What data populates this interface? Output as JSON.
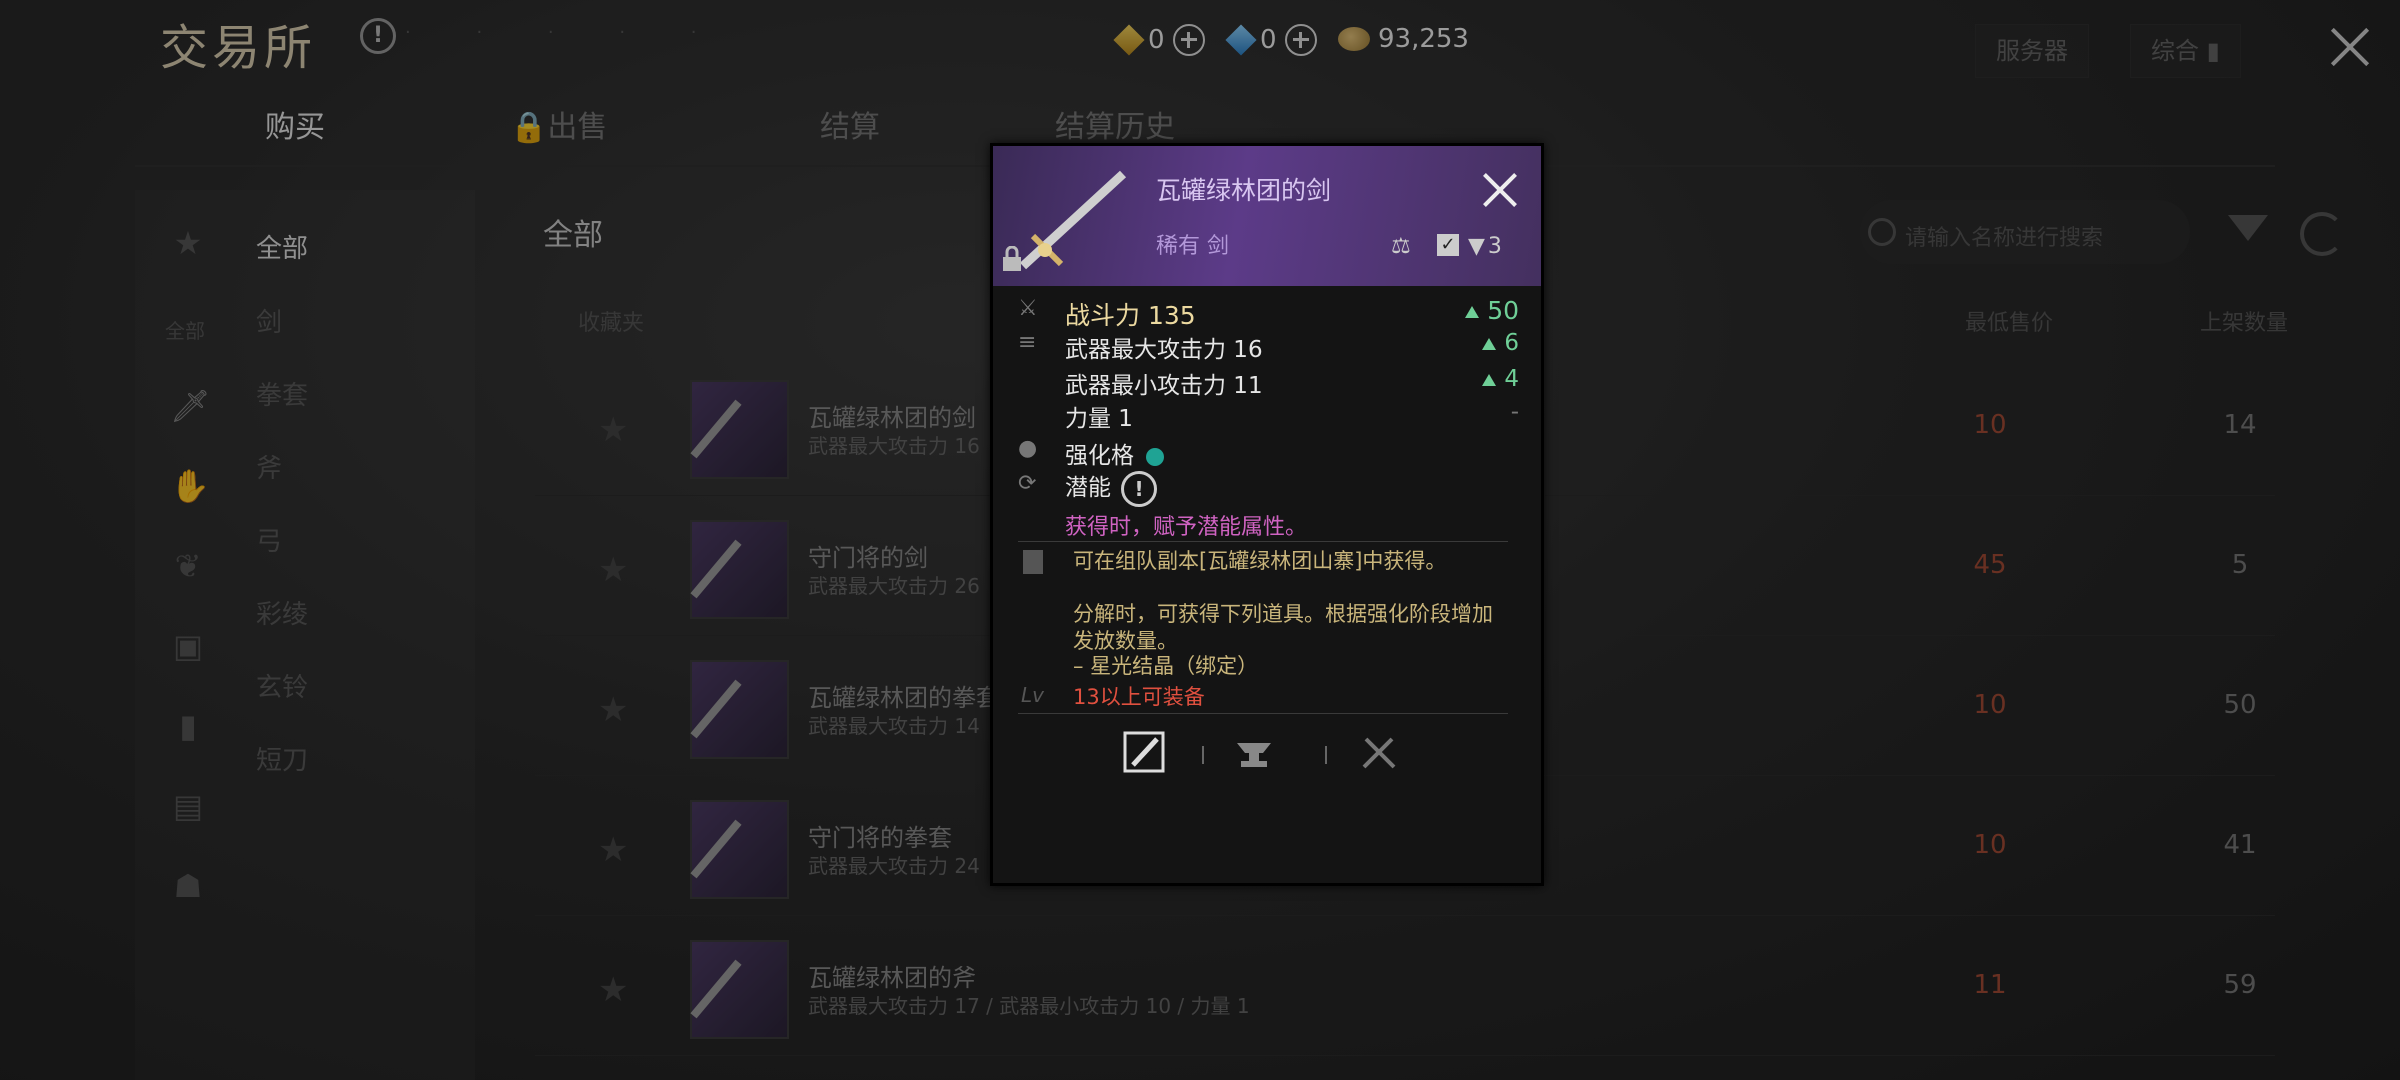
{
  "header": {
    "title": "交易所",
    "currencies": [
      {
        "icon": "gold-gem-icon",
        "value": "0"
      },
      {
        "icon": "blue-gem-icon",
        "value": "0"
      },
      {
        "icon": "coin-icon",
        "value": "93,253"
      }
    ],
    "server_label": "服务器",
    "general_label": "综合"
  },
  "tabs": [
    {
      "label": "购买",
      "active": true
    },
    {
      "label": "出售",
      "locked": true
    },
    {
      "label": "结算"
    },
    {
      "label": "结算历史"
    }
  ],
  "sidebar": {
    "icons": [
      "star-icon",
      "all-label",
      "sword-icon",
      "gauntlet-icon",
      "feather-icon",
      "armor-icon",
      "book-icon",
      "scroll-icon",
      "mask-icon"
    ],
    "all_label": "全部",
    "categories": [
      "全部",
      "剑",
      "拳套",
      "斧",
      "弓",
      "彩绫",
      "玄铃",
      "短刀"
    ]
  },
  "main": {
    "header": "全部",
    "search_placeholder": "请输入名称进行搜索",
    "columns": {
      "favorites": "收藏夹",
      "min_price": "最低售价",
      "quantity": "上架数量"
    },
    "rows": [
      {
        "name": "瓦罐绿林团的剑",
        "stat": "武器最大攻击力 16",
        "price": "10",
        "qty": "14"
      },
      {
        "name": "守门将的剑",
        "stat": "武器最大攻击力 26",
        "price": "45",
        "qty": "5"
      },
      {
        "name": "瓦罐绿林团的拳套",
        "stat": "武器最大攻击力 14",
        "price": "10",
        "qty": "50"
      },
      {
        "name": "守门将的拳套",
        "stat": "武器最大攻击力 24",
        "price": "10",
        "qty": "41"
      },
      {
        "name": "瓦罐绿林团的斧",
        "stat": "武器最大攻击力 17 / 武器最小攻击力 10 / 力量 1",
        "price": "11",
        "qty": "59"
      }
    ]
  },
  "tooltip": {
    "name": "瓦罐绿林团的剑",
    "subtitle": "稀有 剑",
    "stack_count": "3",
    "combat_power_label": "战斗力 135",
    "combat_power_delta": "50",
    "stats": [
      {
        "label": "武器最大攻击力 16",
        "delta": "6"
      },
      {
        "label": "武器最小攻击力 11",
        "delta": "4"
      },
      {
        "label": "力量 1",
        "delta": "-"
      }
    ],
    "socket_label": "强化格",
    "potential_label": "潜能",
    "potential_note": "获得时，赋予潜能属性。",
    "source": "可在组队副本[瓦罐绿林团山寨]中获得。",
    "dismantle": "分解时，可获得下列道具。根据强化阶段增加发放数量。",
    "dismantle_item": "– 星光结晶（绑定）",
    "requirement": "13以上可装备",
    "level_icon_text": "Lv",
    "colors": {
      "header_purple": "#5c3b88",
      "stat_green": "#6fcf97",
      "potential_pink": "#d063c2",
      "requirement_red": "#e0503f",
      "desc_gold": "#c9b57b"
    }
  }
}
